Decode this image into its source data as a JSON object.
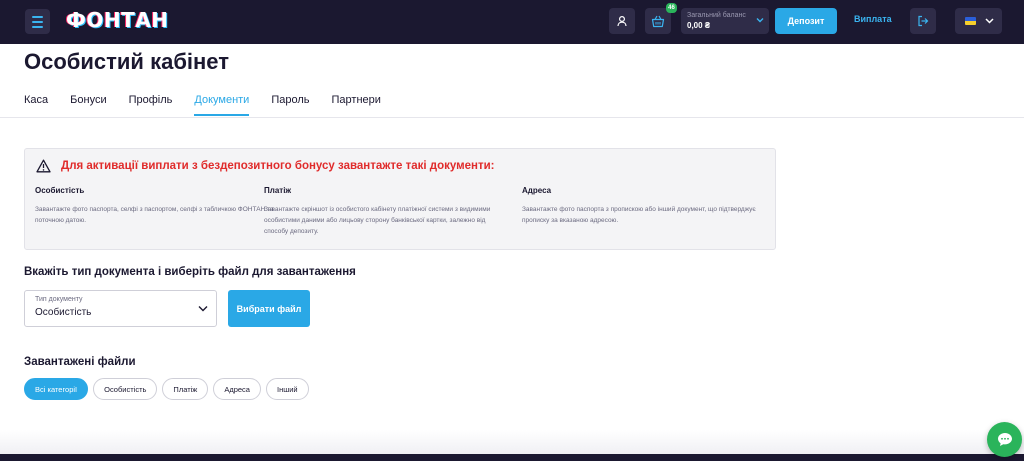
{
  "header": {
    "logo_text": "ФОНТАН",
    "gift_badge": "46",
    "balance_label": "Загальний баланс",
    "balance_value": "0,00 ₴",
    "deposit_label": "Депозит",
    "withdraw_label": "Виплата",
    "language_flag": "ukraine-flag"
  },
  "page": {
    "title": "Особистий кабінет"
  },
  "tabs": [
    {
      "label": "Каса",
      "active": false
    },
    {
      "label": "Бонуси",
      "active": false
    },
    {
      "label": "Профіль",
      "active": false
    },
    {
      "label": "Документи",
      "active": true
    },
    {
      "label": "Пароль",
      "active": false
    },
    {
      "label": "Партнери",
      "active": false
    }
  ],
  "alert": {
    "title": "Для активації виплати з бездепозитного бонусу завантажте такі документи:",
    "columns": [
      {
        "heading": "Особистість",
        "text": "Завантажте фото паспорта, селфі з паспортом, селфі з табличкою ФОНТАН та поточною датою."
      },
      {
        "heading": "Платіж",
        "text": "Завантажте скріншот із особистого кабінету платіжної системи з видимими особистими даними або лицьову сторону банківської картки, залежно від способу депозиту."
      },
      {
        "heading": "Адреса",
        "text": "Завантажте фото паспорта з пропискою або інший документ, що підтверджує прописку за вказаною адресою."
      }
    ]
  },
  "upload": {
    "title": "Вкажіть тип документа і виберіть файл для завантаження",
    "select_label": "Тип документу",
    "select_value": "Особистість",
    "choose_button": "Вибрати файл"
  },
  "files": {
    "title": "Завантажені файли",
    "filters": [
      {
        "label": "Всі категорії",
        "active": true
      },
      {
        "label": "Особистість",
        "active": false
      },
      {
        "label": "Платіж",
        "active": false
      },
      {
        "label": "Адреса",
        "active": false
      },
      {
        "label": "Інший",
        "active": false
      }
    ]
  },
  "colors": {
    "header_bg": "#1b1830",
    "accent": "#2aa8e6",
    "alert_red": "#e02b2b",
    "chat_green": "#2ab45b"
  }
}
